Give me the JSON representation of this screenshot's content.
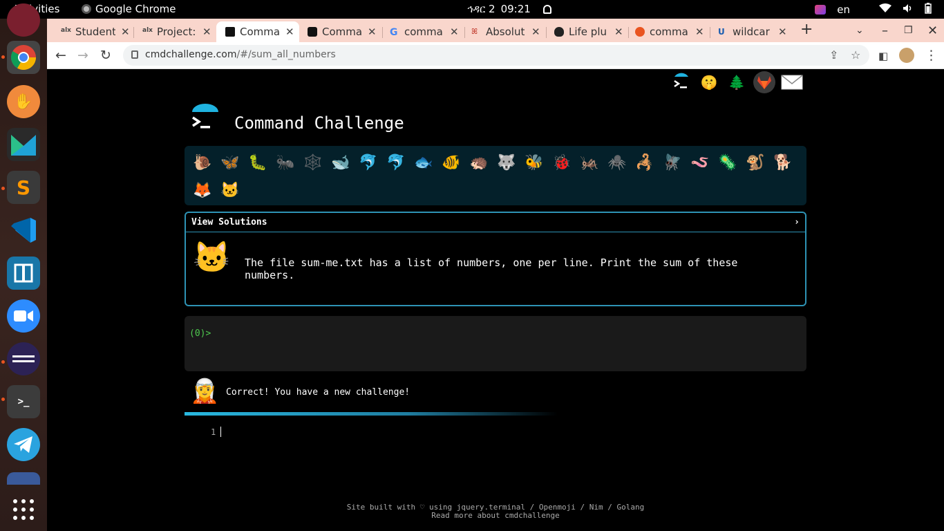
{
  "system_bar": {
    "activities": "Activities",
    "app_name": "Google Chrome",
    "date": "ኅዳር 2",
    "time": "09:21",
    "language": "en"
  },
  "tabs": [
    {
      "title": "Student",
      "icon": "alx-icon",
      "color": "#444"
    },
    {
      "title": "Project:",
      "icon": "alx-icon",
      "color": "#444"
    },
    {
      "title": "Comma",
      "icon": "terminal-icon",
      "color": "#111",
      "active": true
    },
    {
      "title": "Comma",
      "icon": "medium-icon",
      "color": "#111"
    },
    {
      "title": "comma",
      "icon": "google-icon",
      "color": "#4285f4"
    },
    {
      "title": "Absolut",
      "icon": "absolut-icon",
      "color": "#c0392b"
    },
    {
      "title": "Life plu",
      "icon": "linux-penguin-icon",
      "color": "#222"
    },
    {
      "title": "comma",
      "icon": "askubuntu-icon",
      "color": "#e95420"
    },
    {
      "title": "wildcar",
      "icon": "ul-icon",
      "color": "#1a5db0"
    }
  ],
  "address_bar": {
    "domain": "cmdchallenge.com",
    "path": "/#/sum_all_numbers"
  },
  "site": {
    "title": "Command Challenge",
    "animals": [
      "🐌",
      "🦋",
      "🐛",
      "🐜",
      "🕸️",
      "🐋",
      "🐬",
      "🐬",
      "🐟",
      "🐠",
      "🦔",
      "🐺",
      "🐝",
      "🐞",
      "🦗",
      "🕷️",
      "🦂",
      "🪰",
      "🪱",
      "🦠",
      "🐒",
      "🐕",
      "🦊",
      "🐱"
    ],
    "solutions_header": "View Solutions",
    "solutions_chevron": "›",
    "challenge_avatar": "🐱",
    "challenge_text": "The file sum-me.txt has a list of numbers, one per line. Print the sum of these numbers.",
    "prompt": "(0)>",
    "result_avatar": "🧝",
    "result_message": "Correct! You have a new challenge!",
    "editor_line": "1",
    "footer_line1": "Site built with ♡ using jquery.terminal / Openmoji / Nim / Golang",
    "footer_line2": "Read more about cmdchallenge"
  },
  "social_links": [
    {
      "name": "terminal-logo-icon",
      "glyph": ">_"
    },
    {
      "name": "shushing-face-icon",
      "glyph": "🤫"
    },
    {
      "name": "tree-icon",
      "glyph": "🌲"
    },
    {
      "name": "gitlab-icon",
      "glyph": "🦊"
    },
    {
      "name": "mail-icon",
      "glyph": "✉"
    }
  ],
  "colors": {
    "accent": "#2e93b5",
    "tab_strip": "#f9d6cc",
    "prompt_green": "#4ec94e",
    "animals_bg": "#04202a"
  }
}
